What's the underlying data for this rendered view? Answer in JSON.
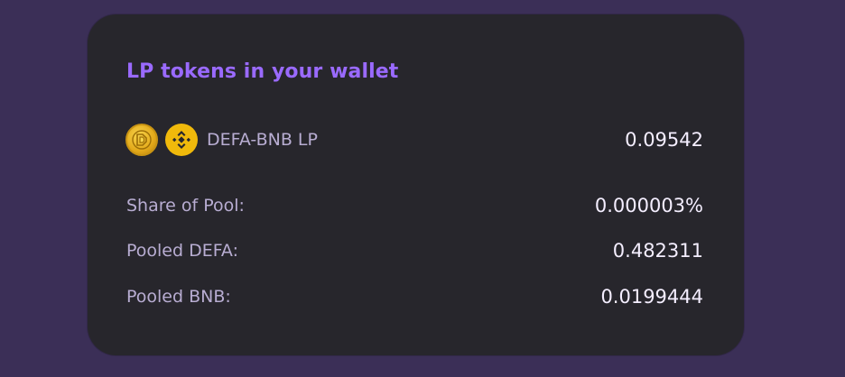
{
  "card": {
    "title": "LP tokens in your wallet",
    "lp_token": {
      "token_a_icon": "defa-coin-icon",
      "token_b_icon": "bnb-coin-icon",
      "pair_label": "DEFA-BNB LP",
      "amount": "0.09542"
    },
    "details": [
      {
        "label": "Share of Pool:",
        "value": "0.000003%"
      },
      {
        "label": "Pooled DEFA:",
        "value": "0.482311"
      },
      {
        "label": "Pooled BNB:",
        "value": "0.0199444"
      }
    ]
  },
  "colors": {
    "background": "#3b2f57",
    "card": "#27262c",
    "title": "#9a6aff",
    "label": "#b8add2",
    "value": "#f4eeff",
    "bnb": "#f0b90b",
    "defa": "#e3a91a"
  }
}
